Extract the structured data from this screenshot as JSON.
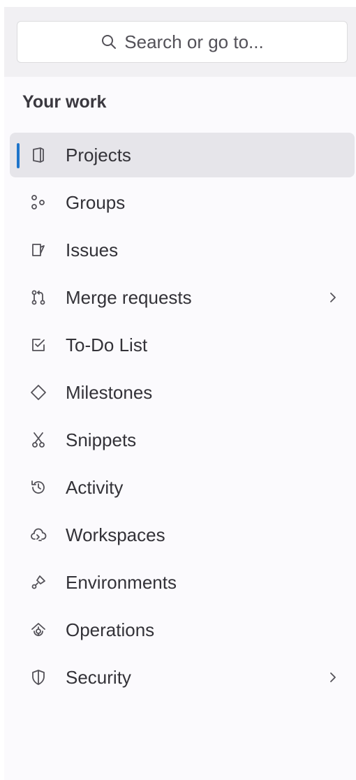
{
  "search": {
    "label": "Search or go to..."
  },
  "section": {
    "title": "Your work"
  },
  "nav": {
    "items": [
      {
        "label": "Projects",
        "icon": "project-icon",
        "active": true
      },
      {
        "label": "Groups",
        "icon": "group-icon"
      },
      {
        "label": "Issues",
        "icon": "issues-icon"
      },
      {
        "label": "Merge requests",
        "icon": "merge-request-icon",
        "has_submenu": true
      },
      {
        "label": "To-Do List",
        "icon": "todo-icon"
      },
      {
        "label": "Milestones",
        "icon": "milestone-icon"
      },
      {
        "label": "Snippets",
        "icon": "snippet-icon"
      },
      {
        "label": "Activity",
        "icon": "history-icon"
      },
      {
        "label": "Workspaces",
        "icon": "workspace-icon"
      },
      {
        "label": "Environments",
        "icon": "environment-icon"
      },
      {
        "label": "Operations",
        "icon": "operations-icon"
      },
      {
        "label": "Security",
        "icon": "shield-icon",
        "has_submenu": true
      }
    ]
  },
  "colors": {
    "accent": "#1f75cb",
    "active_bg": "#e6e5ea",
    "sidebar_bg": "#fbfafd",
    "header_bg": "#f1f0f3",
    "text": "#333238"
  }
}
